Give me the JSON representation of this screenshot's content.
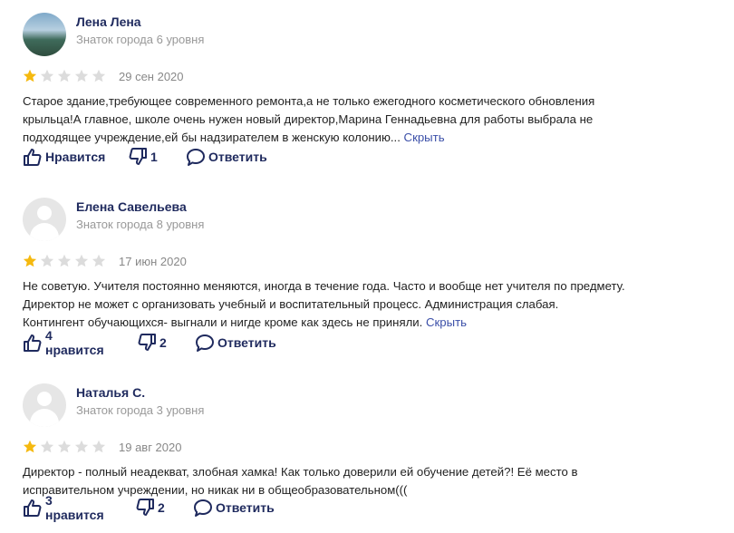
{
  "reviews": [
    {
      "name": "Лена Лена",
      "level": "Знаток города 6 уровня",
      "rating": 1,
      "rating_max": 5,
      "date": "29 сен 2020",
      "text_lines": [
        "Старое здание,требующее современного ремонта,а не только ежегодного косметического обновления",
        "крыльца!А главное, школе очень нужен новый директор,Марина Геннадьевна для работы выбрала не",
        "подходящее учреждение,ей бы надзирателем в женскую колонию..."
      ],
      "hide_label": "Скрыть",
      "like_label": "Нравится",
      "dislike_count": "1",
      "reply_label": "Ответить",
      "avatar": "photo"
    },
    {
      "name": "Елена Савельева",
      "level": "Знаток города 8 уровня",
      "rating": 1,
      "rating_max": 5,
      "date": "17 июн 2020",
      "text_lines": [
        "Не советую. Учителя постоянно меняются, иногда в течение года. Часто и вообще нет учителя по предмету.",
        "Директор не может с организовать учебный и воспитательный процесс. Администрация слабая.",
        "Контингент обучающихся- выгнали и нигде кроме как здесь не приняли."
      ],
      "hide_label": "Скрыть",
      "like_label": "4 нравится",
      "dislike_count": "2",
      "reply_label": "Ответить",
      "avatar": "default"
    },
    {
      "name": "Наталья С.",
      "level": "Знаток города 3 уровня",
      "rating": 1,
      "rating_max": 5,
      "date": "19 авг 2020",
      "text_lines": [
        "Директор - полный неадекват, злобная хамка! Как только доверили ей обучение детей?! Её место в",
        "исправительном учреждении, но никак ни в общеобразовательном((("
      ],
      "hide_label": "",
      "like_label": "3 нравится",
      "dislike_count": "2",
      "reply_label": "Ответить",
      "avatar": "default"
    }
  ],
  "colors": {
    "star_filled": "#f5b90f",
    "star_empty": "#dcdcdc",
    "link": "#3b4fa8",
    "name": "#1f2a5e",
    "muted": "#999999"
  },
  "icons": [
    "thumbs-up-icon",
    "thumbs-down-icon",
    "speech-bubble-icon",
    "star-icon"
  ]
}
